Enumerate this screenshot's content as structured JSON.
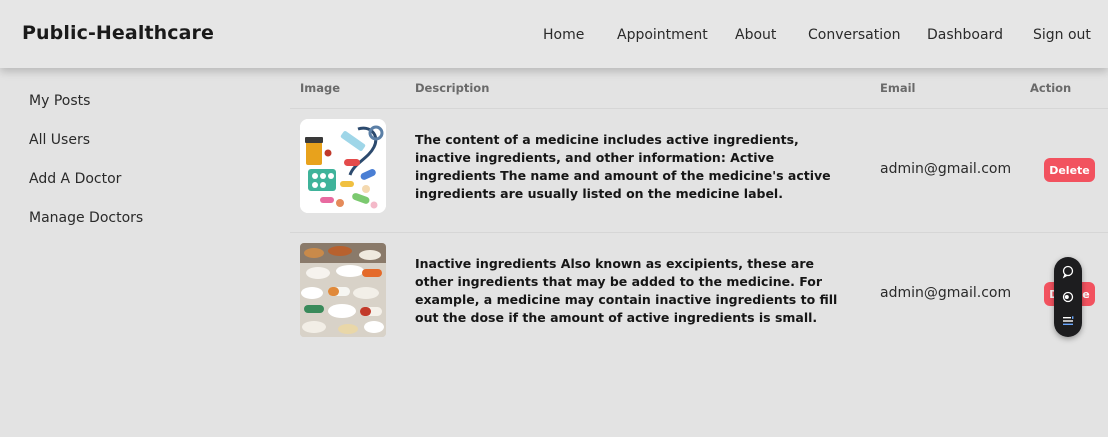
{
  "navbar": {
    "brand": "Public-Healthcare",
    "links": [
      {
        "label": "Home"
      },
      {
        "label": "Appointment"
      },
      {
        "label": "About"
      },
      {
        "label": "Conversation"
      },
      {
        "label": "Dashboard"
      },
      {
        "label": "Sign out"
      }
    ]
  },
  "sidebar": {
    "items": [
      {
        "label": "My Posts"
      },
      {
        "label": "All Users"
      },
      {
        "label": "Add A Doctor"
      },
      {
        "label": "Manage Doctors"
      }
    ]
  },
  "table": {
    "headers": {
      "image": "Image",
      "description": "Description",
      "email": "Email",
      "action": "Action"
    },
    "rows": [
      {
        "description": "The content of a medicine includes active ingredients, inactive ingredients, and other information: Active ingredients The name and amount of the medicine's active ingredients are usually listed on the medicine label.",
        "email": "admin@gmail.com",
        "action_label": "Delete"
      },
      {
        "description": "Inactive ingredients Also known as excipients, these are other ingredients that may be added to the medicine. For example, a medicine may contain inactive ingredients to fill out the dose if the amount of active ingredients is small.",
        "email": "admin@gmail.com",
        "action_label": "Delete"
      }
    ]
  },
  "colors": {
    "background": "#e3e3e3",
    "delete_button": "#f2525f",
    "floating_toolbar": "#1d1d1f"
  },
  "icons": {
    "floating_toolbar": [
      "chat-bubble-icon",
      "toggle-icon",
      "list-menu-icon"
    ]
  }
}
